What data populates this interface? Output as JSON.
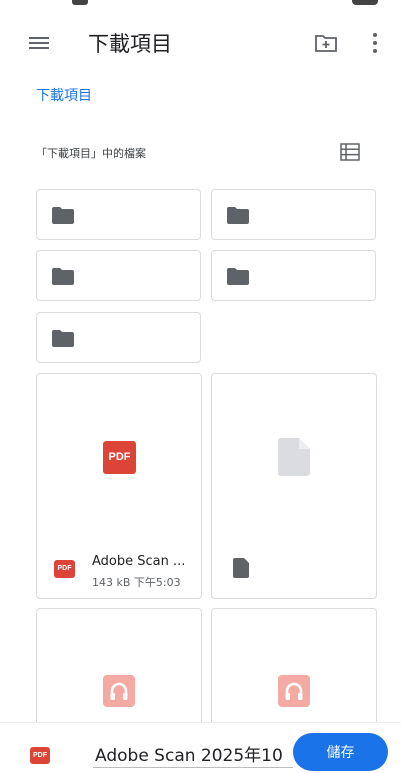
{
  "colors": {
    "accent": "#1a73e8",
    "pdf_red": "#db4437",
    "folder_gray": "#5f6368",
    "card_border": "#dadce0",
    "audio_pink": "#f4a9a2"
  },
  "app_bar": {
    "title": "下載項目",
    "menu_icon": "hamburger-menu-icon",
    "new_folder_icon": "create-new-folder-icon",
    "more_icon": "more-vert-icon"
  },
  "breadcrumb": {
    "current": "下載項目"
  },
  "files_section": {
    "header": "「下載項目」中的檔案",
    "view_toggle_icon": "list-view-icon"
  },
  "folders": [
    {
      "name": "",
      "icon": "folder-icon"
    },
    {
      "name": "",
      "icon": "folder-icon"
    },
    {
      "name": "",
      "icon": "folder-icon"
    },
    {
      "name": "",
      "icon": "folder-icon"
    },
    {
      "name": "",
      "icon": "folder-icon"
    }
  ],
  "files": [
    {
      "thumbnail_label": "PDF",
      "type_badge": "PDF",
      "name": "Adobe Scan ...",
      "meta": "143 kB 下午5:03",
      "icon": "pdf-icon"
    },
    {
      "name": "",
      "meta": "",
      "icon": "generic-file-icon"
    },
    {
      "icon": "audio-file-icon"
    },
    {
      "icon": "audio-file-icon"
    }
  ],
  "save_bar": {
    "file_type_badge": "PDF",
    "filename_value": "Adobe Scan 2025年10",
    "save_label": "儲存"
  }
}
